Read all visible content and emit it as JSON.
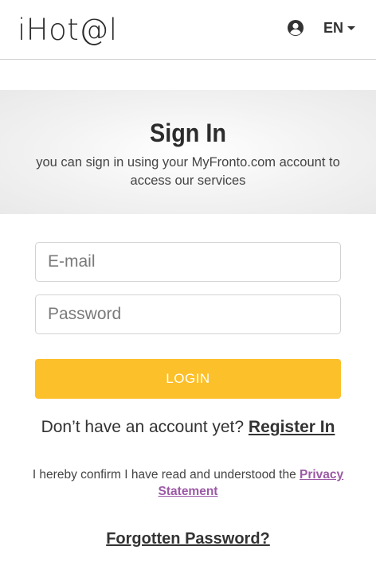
{
  "header": {
    "logo": "iHot@l",
    "user_icon": "user-circle-icon",
    "language": "EN",
    "language_icon": "chevron-down-icon"
  },
  "banner": {
    "title": "Sign In",
    "subtitle": "you can sign in using your MyFronto.com account to access our services"
  },
  "form": {
    "email_placeholder": "E-mail",
    "email_value": "",
    "password_placeholder": "Password",
    "password_value": "",
    "login_label": "LOGIN"
  },
  "register": {
    "prompt": "Don’t have an account yet? ",
    "link": "Register In"
  },
  "privacy": {
    "text": "I hereby confirm I have read and understood the ",
    "link": "Privacy Statement"
  },
  "forgot": {
    "link": "Forgotten Password?"
  },
  "colors": {
    "accent": "#fcc02a",
    "privacy_link": "#9b59a5",
    "text": "#333333"
  }
}
